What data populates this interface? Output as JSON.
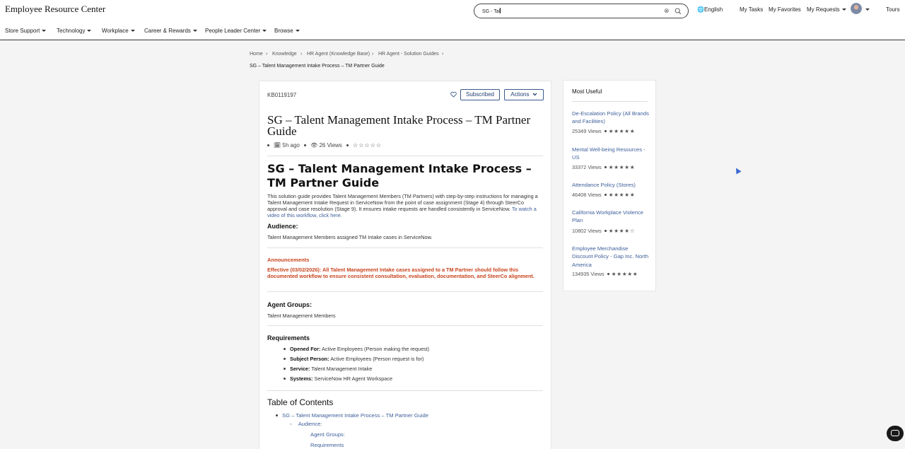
{
  "header": {
    "brand": "Employee Resource Center",
    "search_value": "SG - Tal",
    "language": "English",
    "my_tasks": "My Tasks",
    "my_favorites": "My Favorites",
    "my_requests": "My Requests",
    "tours": "Tours"
  },
  "nav": [
    "Store Support",
    "Technology",
    "Workplace",
    "Career & Rewards",
    "People Leader Center",
    "Browse"
  ],
  "breadcrumb": [
    "Home",
    "Knowledge",
    "HR Agent (Knowledge Base)",
    "HR Agent - Solution Guides"
  ],
  "breadcrumb_current": "SG – Talent Management Intake Process – TM Partner Guide",
  "article": {
    "number": "KB0119197",
    "subscribed": "Subscribed",
    "actions": "Actions",
    "title": "SG – Talent Management Intake Process – TM Partner Guide",
    "age": "5h ago",
    "views": "26 Views",
    "stars": "☆☆☆☆☆",
    "heading": "SG – Talent Management Intake Process – TM Partner Guide",
    "intro": "This solution guide provides Talent Management Members (TM Partners) with step-by-step instructions for managing a Talent Management Intake Request in ServiceNow from the point of case assignment (Stage 4) through SteerCo approval and case resolution (Stage 9). It ensures intake requests are handled consistently in ServiceNow.",
    "intro_link": "To watch a video of this workflow, click here.",
    "audience_label": "Audience:",
    "audience_text": "Talent Management Members assigned TM Intake cases in ServiceNow.",
    "announcements_label": "Announcements",
    "announcement": "Effective (03/02/2026): All Talent Management Intake cases assigned to a TM Partner should follow this documented workflow to ensure consistent consultation, evaluation, documentation, and SteerCo alignment.",
    "agent_groups_label": "Agent Groups:",
    "agent_groups_text": "Talent Management Members",
    "requirements_label": "Requirements",
    "requirements": [
      {
        "label": "Opened For:",
        "value": "Active Employees (Person making the request)"
      },
      {
        "label": "Subject Person:",
        "value": "Active Employees (Person request is for)"
      },
      {
        "label": "Service:",
        "value": "Talent Management Intake"
      },
      {
        "label": "Systems:",
        "value": "ServiceNow HR Agent Workspace"
      }
    ],
    "toc_label": "Table of Contents",
    "toc": [
      "SG – Talent Management Intake Process – TM Partner Guide",
      "Audience:",
      "Agent Groups:",
      "Requirements"
    ]
  },
  "most_useful": {
    "title": "Most Useful",
    "items": [
      {
        "title": "De-Escalation Policy (All Brands and Facilities)",
        "views": "25349 Views",
        "stars": "★★★★★"
      },
      {
        "title": "Mental Well-being Resources - US",
        "views": "33372 Views",
        "stars": "★★★★★"
      },
      {
        "title": "Attendance Policy (Stores)",
        "views": "46408 Views",
        "stars": "★★★★★"
      },
      {
        "title": "California Workplace Violence Plan",
        "views": "10802 Views",
        "stars": "★★★★☆"
      },
      {
        "title": "Employee Merchandise Discount Policy - Gap Inc. North America",
        "views": "134935 Views",
        "stars": "★★★★★"
      }
    ]
  }
}
